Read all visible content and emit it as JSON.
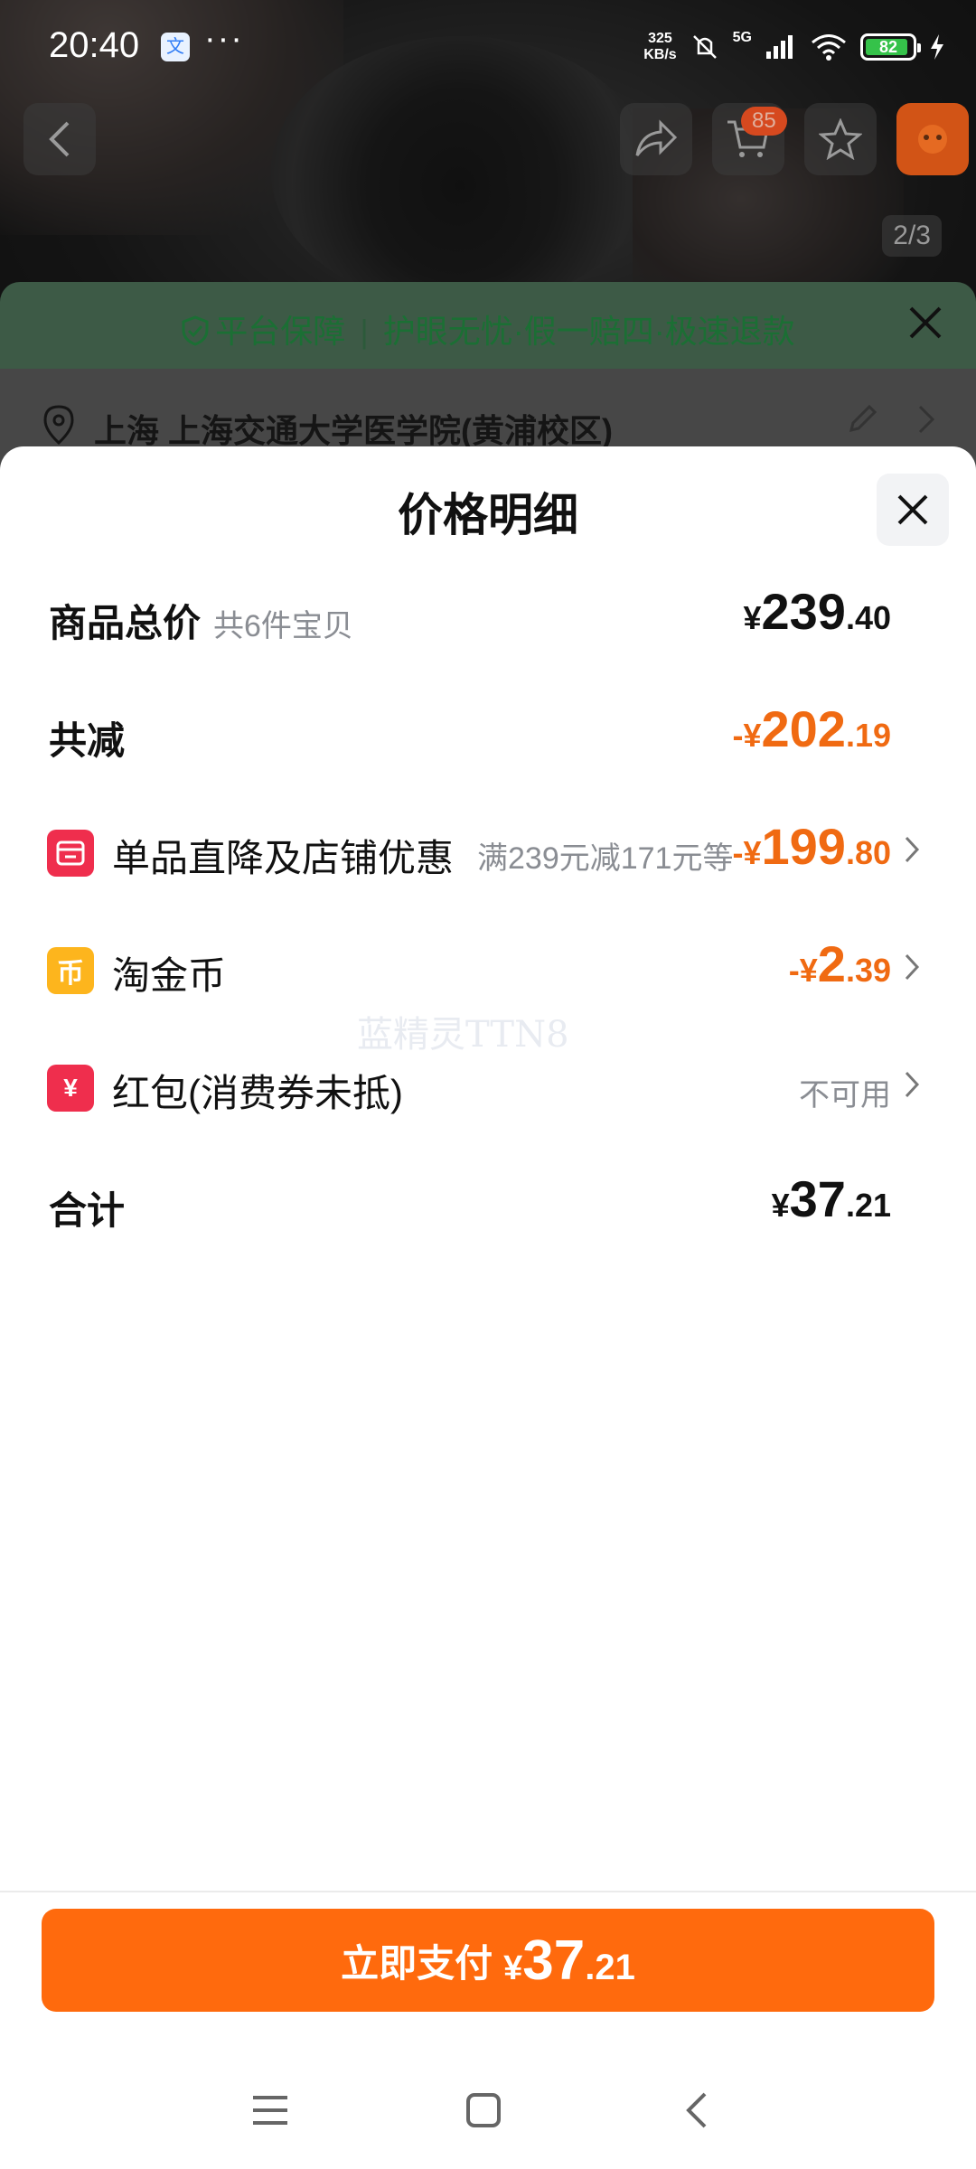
{
  "status_bar": {
    "time": "20:40",
    "app_icon": "文",
    "more": "···",
    "net_speed_value": "325",
    "net_speed_unit": "KB/s",
    "network": "5G",
    "battery": "82",
    "icons": [
      "mute-vibrate-icon",
      "signal-icon",
      "wifi-icon",
      "charging-icon"
    ]
  },
  "header": {
    "cart_count": "85",
    "image_index": "2/3"
  },
  "guarantee": {
    "platform": "平台保障",
    "separator": "|",
    "items": "护眼无忧·假一赔四·极速退款"
  },
  "address": {
    "text": "上海 上海交通大学医学院(黄浦校区)"
  },
  "sheet": {
    "title": "价格明细",
    "rows": [
      {
        "label": "商品总价",
        "sub": "共6件宝贝",
        "currency": "¥",
        "int": "239",
        "dec": ".40"
      },
      {
        "label": "共减",
        "currency": "-¥",
        "int": "202",
        "dec": ".19"
      },
      {
        "label": "单品直降及店铺优惠",
        "note": "满239元减171元等",
        "currency": "-¥",
        "int": "199",
        "dec": ".80"
      },
      {
        "label": "淘金币",
        "currency": "-¥",
        "int": "2",
        "dec": ".39"
      },
      {
        "label": "红包(消费券未抵)",
        "status": "不可用"
      },
      {
        "label": "合计",
        "currency": "¥",
        "int": "37",
        "dec": ".21"
      }
    ],
    "watermark": "蓝精灵TTN8"
  },
  "pay": {
    "label": "立即支付",
    "currency": "¥",
    "int": "37",
    "dec": ".21"
  },
  "colors": {
    "accent": "#ff6a0d",
    "discount": "#f06a12",
    "badge_red": "#ef2e4d",
    "badge_gold": "#fdb51d",
    "guarantee_green": "#1b6f34"
  }
}
